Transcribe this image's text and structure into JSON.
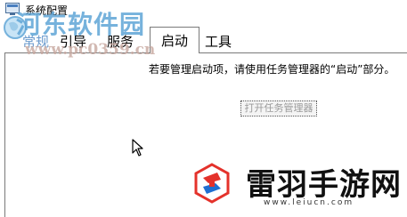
{
  "window": {
    "title": "系统配置"
  },
  "tabs": {
    "general": "常规",
    "boot": "引导",
    "services": "服务",
    "startup": "启动",
    "tools": "工具"
  },
  "startup_panel": {
    "message": "若要管理启动项，请使用任务管理器的“启动”部分。",
    "open_task_manager_button": "打开任务管理器"
  },
  "watermarks": {
    "site_name": "河东软件园",
    "site_url": "www.pc0359.cn",
    "brand_name": "雷羽手游网",
    "brand_url": "www.leiucn.com"
  },
  "colors": {
    "accent": "#6a9acd",
    "brand_red": "#e4322b",
    "brand_blue": "#1f6fd1"
  },
  "icons": {
    "app": "system-config-icon",
    "cursor": "mouse-pointer-icon",
    "watermark": "globe-icon",
    "brand": "brand-logo"
  }
}
